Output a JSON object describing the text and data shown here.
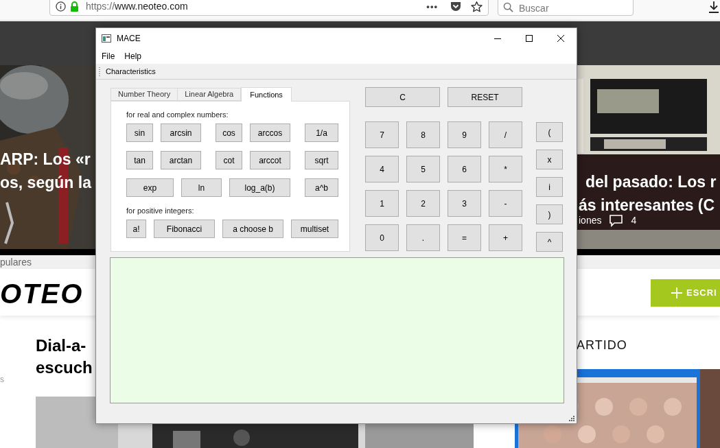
{
  "browser": {
    "url_scheme": "https://",
    "url_host": "www.neoteo.com",
    "menu_dots": "•••",
    "search": {
      "placeholder": "Buscar"
    }
  },
  "background_page": {
    "hero_left": [
      "ARP: Los «r",
      "os, según la"
    ],
    "hero_right": [
      "del pasado: Los r",
      "ás interesantes (C"
    ],
    "hero_meta": "iones",
    "comment_count": "4",
    "section_label": "pulares",
    "logo": "OTEO",
    "write_button": "ESCRI",
    "sidebar_heading": "ARTIDO",
    "article_title": [
      "Dial-a-",
      "escuch"
    ],
    "side_letter": "s"
  },
  "window": {
    "title": "MACE",
    "menu": [
      "File",
      "Help"
    ],
    "toolbar": "Characteristics",
    "tabs": [
      {
        "label": "Number Theory",
        "selected": false
      },
      {
        "label": "Linear Algebra",
        "selected": false
      },
      {
        "label": "Functions",
        "selected": true
      }
    ],
    "function_groups": [
      {
        "label": "for real and complex numbers:",
        "rows": [
          {
            "buttons": [
              "sin",
              "arcsin",
              "cos",
              "arccos",
              "1/a"
            ]
          },
          {
            "buttons": [
              "tan",
              "arctan",
              "cot",
              "arccot",
              "sqrt"
            ]
          },
          {
            "buttons": [
              "exp",
              "ln",
              "log_a(b)",
              "a^b"
            ]
          }
        ]
      },
      {
        "label": "for positive integers:",
        "rows": [
          {
            "buttons": [
              "a!",
              "Fibonacci",
              "a choose b",
              "multiset"
            ]
          }
        ]
      }
    ],
    "top_buttons": [
      "C",
      "RESET"
    ],
    "keypad": [
      [
        "7",
        "8",
        "9",
        "/"
      ],
      [
        "4",
        "5",
        "6",
        "*"
      ],
      [
        "1",
        "2",
        "3",
        "-"
      ],
      [
        "0",
        ".",
        "=",
        "+"
      ]
    ],
    "side_keys": [
      "(",
      "x",
      "i",
      ")",
      "^"
    ]
  }
}
